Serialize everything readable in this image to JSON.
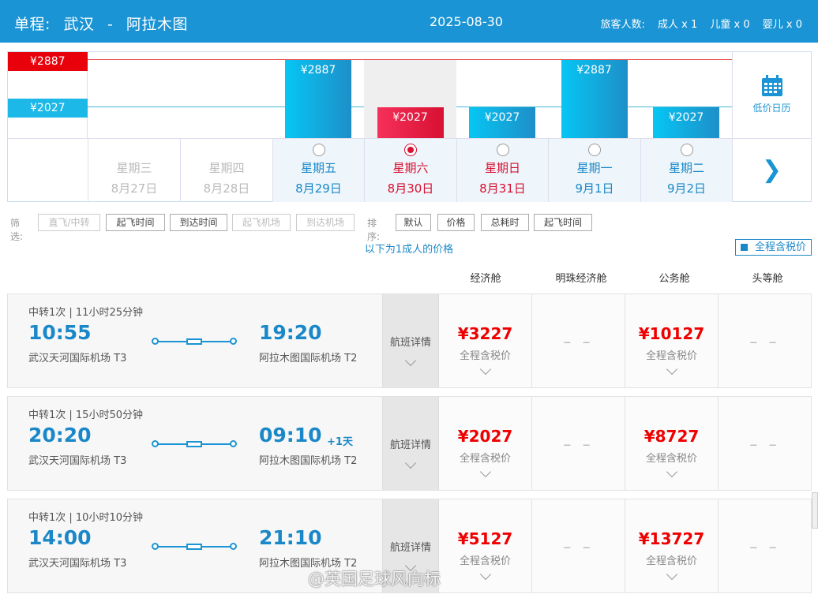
{
  "header": {
    "trip_type": "单程:",
    "from": "武汉",
    "dash": "-",
    "to": "阿拉木图",
    "date": "2025-08-30",
    "pax_label": "旅客人数:",
    "adult": "成人 x 1",
    "child": "儿童 x 0",
    "infant": "婴儿 x 0"
  },
  "calendar": {
    "max_price": "¥2887",
    "min_price": "¥2027",
    "low_price_label": "低价日历",
    "days": [
      {
        "weekday": "星期三",
        "date": "8月27日",
        "price": null,
        "state": "past"
      },
      {
        "weekday": "星期四",
        "date": "8月28日",
        "price": null,
        "state": "past"
      },
      {
        "weekday": "星期五",
        "date": "8月29日",
        "price": "¥2887",
        "state": "future"
      },
      {
        "weekday": "星期六",
        "date": "8月30日",
        "price": "¥2027",
        "state": "selected"
      },
      {
        "weekday": "星期日",
        "date": "8月31日",
        "price": "¥2027",
        "state": "weekend"
      },
      {
        "weekday": "星期一",
        "date": "9月1日",
        "price": "¥2887",
        "state": "future"
      },
      {
        "weekday": "星期二",
        "date": "9月2日",
        "price": "¥2027",
        "state": "future"
      }
    ],
    "bar_levels": [
      null,
      null,
      1.0,
      0.0,
      0.0,
      1.0,
      0.0
    ]
  },
  "filters": {
    "filter_label": "筛选:",
    "direct": "直飞/中转",
    "dep_time": "起飞时间",
    "arr_time": "到达时间",
    "dep_airport": "起飞机场",
    "arr_airport": "到达机场",
    "sort_label": "排序:",
    "default": "默认",
    "price": "价格",
    "duration": "总耗时",
    "sort_dep_time": "起飞时间"
  },
  "note": "以下为1成人的价格",
  "tax_toggle": "全程含税价",
  "columns": [
    "经济舱",
    "明珠经济舱",
    "公务舱",
    "头等舱"
  ],
  "flights": [
    {
      "info": "中转1次 | 11小时25分钟",
      "dep_time": "10:55",
      "dep_airport": "武汉天河国际机场 T3",
      "arr_time": "19:20",
      "plus_day": "",
      "arr_airport": "阿拉木图国际机场 T2",
      "detail": "航班详情",
      "economy": "¥3227",
      "premium": "– –",
      "business": "¥10127",
      "first": "– –",
      "tax_note": "全程含税价"
    },
    {
      "info": "中转1次 | 15小时50分钟",
      "dep_time": "20:20",
      "dep_airport": "武汉天河国际机场 T3",
      "arr_time": "09:10",
      "plus_day": "+1天",
      "arr_airport": "阿拉木图国际机场 T2",
      "detail": "航班详情",
      "economy": "¥2027",
      "premium": "– –",
      "business": "¥8727",
      "first": "– –",
      "tax_note": "全程含税价"
    },
    {
      "info": "中转1次 | 10小时10分钟",
      "dep_time": "14:00",
      "dep_airport": "武汉天河国际机场 T3",
      "arr_time": "21:10",
      "plus_day": "",
      "arr_airport": "阿拉木图国际机场 T2",
      "detail": "航班详情",
      "economy": "¥5127",
      "premium": "– –",
      "business": "¥13727",
      "first": "– –",
      "tax_note": "全程含税价"
    }
  ],
  "watermark": "@英国足球风向标",
  "colors": {
    "header": "#1a94d4",
    "price_red": "#e00000",
    "accent_blue": "#1a88c8",
    "selected_red": "#d81032"
  }
}
